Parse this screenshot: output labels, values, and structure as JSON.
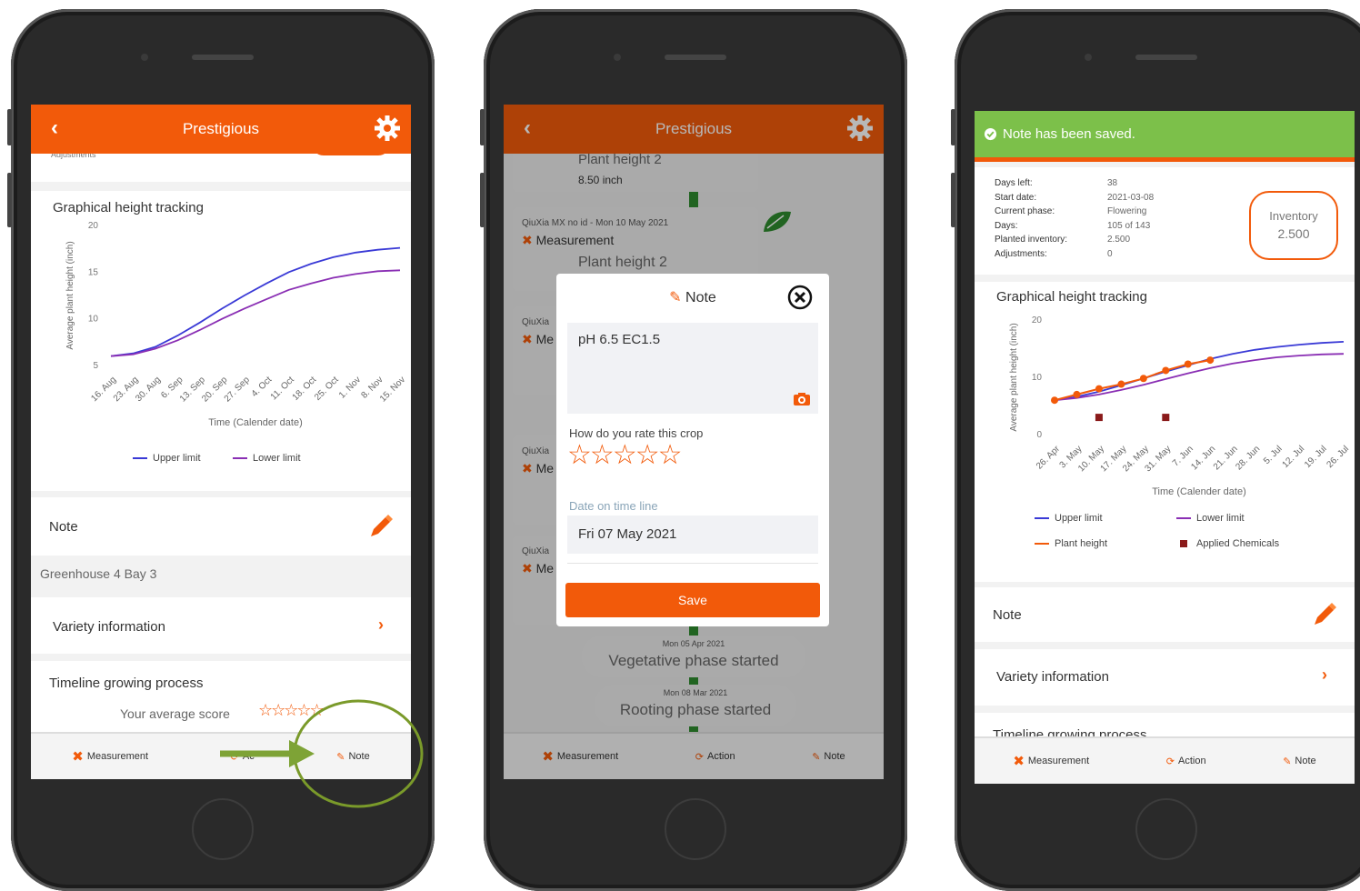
{
  "app": {
    "title": "Prestigious"
  },
  "colors": {
    "accent": "#f25a0a",
    "upper": "#3a3ad6",
    "lower": "#8a2fb4",
    "success": "#7cc04a"
  },
  "phone1": {
    "cutoff_text": "Adjustments",
    "chart": {
      "title": "Graphical height tracking",
      "ylabel": "Average plant height (inch)",
      "xlabel": "Time (Calender date)",
      "yticks": [
        "20",
        "15",
        "10",
        "5"
      ],
      "xticks": [
        "16. Aug",
        "23. Aug",
        "30. Aug",
        "6. Sep",
        "13. Sep",
        "20. Sep",
        "27. Sep",
        "4. Oct",
        "11. Oct",
        "18. Oct",
        "25. Oct",
        "1. Nov",
        "8. Nov",
        "15. Nov"
      ],
      "legend_upper": "Upper limit",
      "legend_lower": "Lower limit"
    },
    "note_label": "Note",
    "location": "Greenhouse 4 Bay 3",
    "variety": "Variety information",
    "timeline": "Timeline growing process",
    "avg_score": "Your average score",
    "bottom": {
      "measurement": "Measurement",
      "action": "Ac",
      "note": "Note"
    }
  },
  "phone2": {
    "tl1": {
      "label": "Plant height 2",
      "value": "8.50 inch"
    },
    "tl2": {
      "meta": "QiuXia MX no id - Mon 10 May 2021",
      "type": "Measurement",
      "label": "Plant height 2"
    },
    "tl3": {
      "meta": "QiuXia",
      "type": "Me"
    },
    "tl4": {
      "meta": "QiuXia",
      "type": "Me"
    },
    "tl5": {
      "meta": "QiuXia",
      "type": "Me"
    },
    "phase1": {
      "date": "Mon 05 Apr 2021",
      "label": "Vegetative phase started"
    },
    "phase2": {
      "date": "Mon 08 Mar 2021",
      "label": "Rooting phase started"
    },
    "modal": {
      "title": "Note",
      "text": "pH 6.5 EC1.5",
      "rate_label": "How do you rate this crop",
      "date_label": "Date on time line",
      "date_value": "Fri 07 May 2021",
      "save": "Save"
    },
    "bottom": {
      "measurement": "Measurement",
      "action": "Action",
      "note": "Note"
    }
  },
  "phone3": {
    "banner": "Note has been saved.",
    "info": {
      "days_left_label": "Days left:",
      "days_left": "38",
      "start_label": "Start date:",
      "start": "2021-03-08",
      "phase_label": "Current phase:",
      "phase": "Flowering",
      "days_label": "Days:",
      "days": "105 of 143",
      "planted_label": "Planted inventory:",
      "planted": "2.500",
      "adj_label": "Adjustments:",
      "adj": "0"
    },
    "inventory": {
      "label": "Inventory",
      "value": "2.500"
    },
    "chart": {
      "title": "Graphical height tracking",
      "ylabel": "Average plant height (inch)",
      "xlabel": "Time (Calender date)",
      "yticks": [
        "20",
        "10",
        "0"
      ],
      "xticks": [
        "26. Apr",
        "3. May",
        "10. May",
        "17. May",
        "24. May",
        "31. May",
        "7. Jun",
        "14. Jun",
        "21. Jun",
        "28. Jun",
        "5. Jul",
        "12. Jul",
        "19. Jul",
        "26. Jul"
      ],
      "legend_upper": "Upper limit",
      "legend_lower": "Lower limit",
      "legend_plant": "Plant height",
      "legend_chem": "Applied Chemicals"
    },
    "note_label": "Note",
    "variety": "Variety information",
    "timeline": "Timeline growing process",
    "bottom": {
      "measurement": "Measurement",
      "action": "Action",
      "note": "Note"
    }
  },
  "chart_data": [
    {
      "type": "line",
      "title": "Graphical height tracking",
      "xlabel": "Time (Calender date)",
      "ylabel": "Average plant height (inch)",
      "ylim": [
        5,
        20
      ],
      "categories": [
        "16. Aug",
        "23. Aug",
        "30. Aug",
        "6. Sep",
        "13. Sep",
        "20. Sep",
        "27. Sep",
        "4. Oct",
        "11. Oct",
        "18. Oct",
        "25. Oct",
        "1. Nov",
        "8. Nov",
        "15. Nov"
      ],
      "series": [
        {
          "name": "Upper limit",
          "values": [
            6.0,
            6.3,
            7.0,
            8.2,
            9.6,
            11.1,
            12.5,
            13.8,
            15.0,
            15.9,
            16.6,
            17.1,
            17.4,
            17.6
          ]
        },
        {
          "name": "Lower limit",
          "values": [
            6.0,
            6.2,
            6.8,
            7.7,
            8.8,
            10.0,
            11.1,
            12.1,
            13.1,
            13.8,
            14.4,
            14.8,
            15.1,
            15.2
          ]
        }
      ]
    },
    {
      "type": "line",
      "title": "Graphical height tracking",
      "xlabel": "Time (Calender date)",
      "ylabel": "Average plant height (inch)",
      "ylim": [
        0,
        20
      ],
      "categories": [
        "26. Apr",
        "3. May",
        "10. May",
        "17. May",
        "24. May",
        "31. May",
        "7. Jun",
        "14. Jun",
        "21. Jun",
        "28. Jun",
        "5. Jul",
        "12. Jul",
        "19. Jul",
        "26. Jul"
      ],
      "series": [
        {
          "name": "Upper limit",
          "values": [
            6.0,
            6.6,
            7.5,
            8.6,
            9.8,
            11.0,
            12.1,
            13.2,
            14.1,
            14.8,
            15.3,
            15.7,
            16.0,
            16.2
          ]
        },
        {
          "name": "Lower limit",
          "values": [
            6.0,
            6.4,
            7.0,
            7.8,
            8.7,
            9.7,
            10.7,
            11.6,
            12.4,
            13.0,
            13.5,
            13.8,
            14.0,
            14.1
          ]
        },
        {
          "name": "Plant height",
          "values": [
            6.0,
            7.0,
            8.0,
            8.8,
            9.8,
            11.2,
            12.3,
            13.0,
            null,
            null,
            null,
            null,
            null,
            null
          ]
        },
        {
          "name": "Applied Chemicals",
          "values": [
            null,
            null,
            3.0,
            null,
            null,
            3.0,
            null,
            null,
            null,
            null,
            null,
            null,
            null,
            null
          ]
        }
      ]
    }
  ]
}
